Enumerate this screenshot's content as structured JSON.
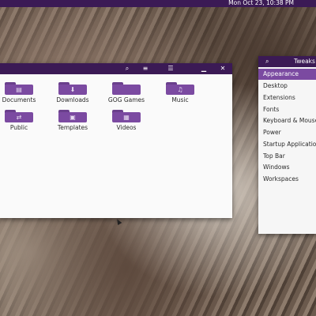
{
  "topbar": {
    "clock": "Mon Oct 23, 10:38 PM"
  },
  "file_manager": {
    "header_icons": [
      "search-icon",
      "view-list-icon",
      "menu-icon",
      "minimize-icon",
      "close-icon"
    ],
    "header_glyphs": {
      "search": "⌕",
      "view": "≡",
      "menu": "☰",
      "minimize": "▁",
      "close": "✕"
    },
    "items": [
      {
        "label": "Documents",
        "icon": "document-folder-icon",
        "glyph": "▤"
      },
      {
        "label": "Downloads",
        "icon": "download-folder-icon",
        "glyph": "⬇"
      },
      {
        "label": "GOG Games",
        "icon": "folder-icon",
        "glyph": ""
      },
      {
        "label": "Music",
        "icon": "music-folder-icon",
        "glyph": "♫"
      },
      {
        "label": "Public",
        "icon": "public-folder-icon",
        "glyph": "⇄"
      },
      {
        "label": "Templates",
        "icon": "templates-folder-icon",
        "glyph": "▣"
      },
      {
        "label": "Videos",
        "icon": "video-folder-icon",
        "glyph": "▦"
      }
    ]
  },
  "tweaks": {
    "title": "Tweaks",
    "search_glyph": "⌕",
    "items": [
      {
        "label": "Appearance",
        "selected": true
      },
      {
        "label": "Desktop",
        "selected": false
      },
      {
        "label": "Extensions",
        "selected": false
      },
      {
        "label": "Fonts",
        "selected": false
      },
      {
        "label": "Keyboard & Mouse",
        "selected": false
      },
      {
        "label": "Power",
        "selected": false
      },
      {
        "label": "Startup Applications",
        "selected": false
      },
      {
        "label": "Top Bar",
        "selected": false
      },
      {
        "label": "Windows",
        "selected": false
      },
      {
        "label": "Workspaces",
        "selected": false
      }
    ]
  },
  "colors": {
    "accent": "#7b4aa1",
    "topbar": "#3b1a55"
  }
}
